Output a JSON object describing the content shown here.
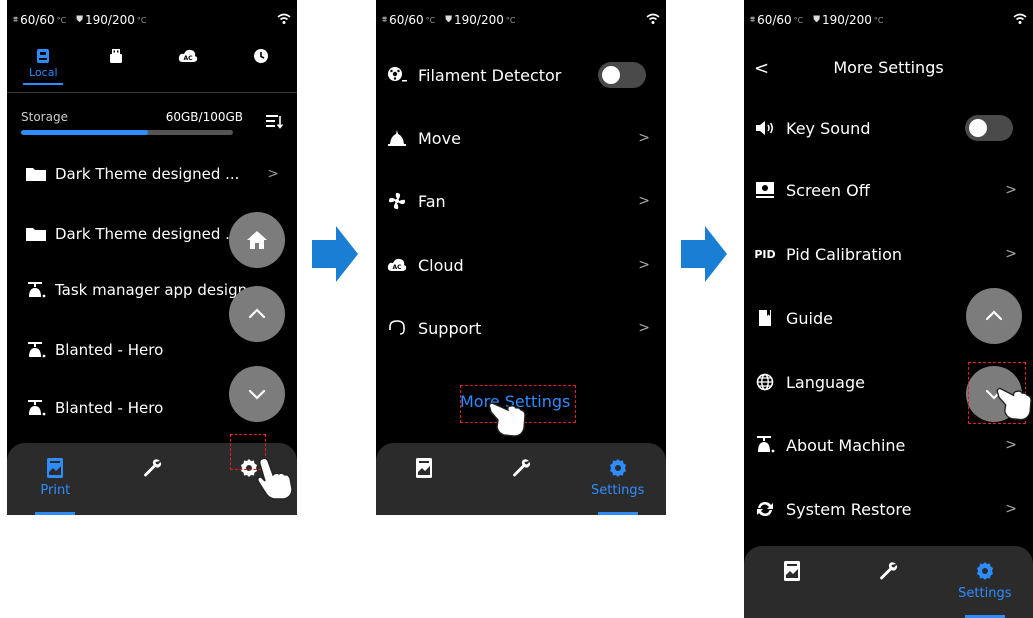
{
  "status_bar": {
    "bed_temp": "60/60",
    "nozzle_temp": "190/200",
    "unit": "°C"
  },
  "screen1": {
    "source_tabs": [
      {
        "label": "Local",
        "icon": "usb-drive-icon",
        "active": true
      },
      {
        "label": "",
        "icon": "usb-stick-icon",
        "active": false
      },
      {
        "label": "",
        "icon": "cloud-ac-icon",
        "active": false
      },
      {
        "label": "",
        "icon": "clock-icon",
        "active": false
      }
    ],
    "storage": {
      "label": "Storage",
      "value": "60GB/100GB",
      "used_fraction": 0.6
    },
    "files": [
      {
        "name": "Dark Theme designed ...",
        "type": "folder",
        "chevron": ">"
      },
      {
        "name": "Dark Theme designed ...",
        "type": "folder",
        "chevron": ""
      },
      {
        "name": "Task manager app design",
        "type": "model",
        "chevron": ""
      },
      {
        "name": "Blanted - Hero",
        "type": "model",
        "chevron": ""
      },
      {
        "name": "Blanted - Hero",
        "type": "model",
        "chevron": ""
      }
    ],
    "fab_icons": [
      "home-icon",
      "chevron-up-icon",
      "chevron-down-icon"
    ],
    "nav": [
      {
        "label": "Print",
        "icon": "print-icon",
        "active": true
      },
      {
        "label": "",
        "icon": "wrench-icon",
        "active": false
      },
      {
        "label": "",
        "icon": "gear-icon",
        "active": false
      }
    ]
  },
  "screen2": {
    "items": [
      {
        "label": "Filament Detector",
        "icon": "filament-icon",
        "control": "toggle"
      },
      {
        "label": "Move",
        "icon": "move-icon",
        "control": "chevron"
      },
      {
        "label": "Fan",
        "icon": "fan-icon",
        "control": "chevron"
      },
      {
        "label": "Cloud",
        "icon": "cloud-icon",
        "control": "chevron"
      },
      {
        "label": "Support",
        "icon": "support-icon",
        "control": "chevron"
      }
    ],
    "more_settings": "More Settings",
    "nav": [
      {
        "label": "",
        "icon": "print-icon",
        "active": false
      },
      {
        "label": "",
        "icon": "wrench-icon",
        "active": false
      },
      {
        "label": "Settings",
        "icon": "gear-icon",
        "active": true
      }
    ]
  },
  "screen3": {
    "title": "More Settings",
    "back": "<",
    "items": [
      {
        "label": "Key Sound",
        "icon": "speaker-icon",
        "control": "toggle"
      },
      {
        "label": "Screen Off",
        "icon": "monitor-icon",
        "control": "chevron"
      },
      {
        "label": "Pid Calibration",
        "icon": "pid-icon",
        "icon_text": "PID",
        "control": "chevron"
      },
      {
        "label": "Guide",
        "icon": "book-icon",
        "control": "none"
      },
      {
        "label": "Language",
        "icon": "globe-icon",
        "control": "none"
      },
      {
        "label": "About Machine",
        "icon": "machine-icon",
        "control": "chevron"
      },
      {
        "label": "System Restore",
        "icon": "restore-icon",
        "control": "chevron"
      }
    ],
    "nav": [
      {
        "label": "",
        "icon": "print-icon",
        "active": false
      },
      {
        "label": "",
        "icon": "wrench-icon",
        "active": false
      },
      {
        "label": "Settings",
        "icon": "gear-icon",
        "active": true
      }
    ]
  },
  "colors": {
    "accent": "#2f8cff",
    "background": "#000000",
    "nav_bg": "#2b2b2b",
    "fab": "#7c7c7c",
    "highlight": "#e02020",
    "arrow": "#1a7fd4"
  },
  "chevron": ">"
}
